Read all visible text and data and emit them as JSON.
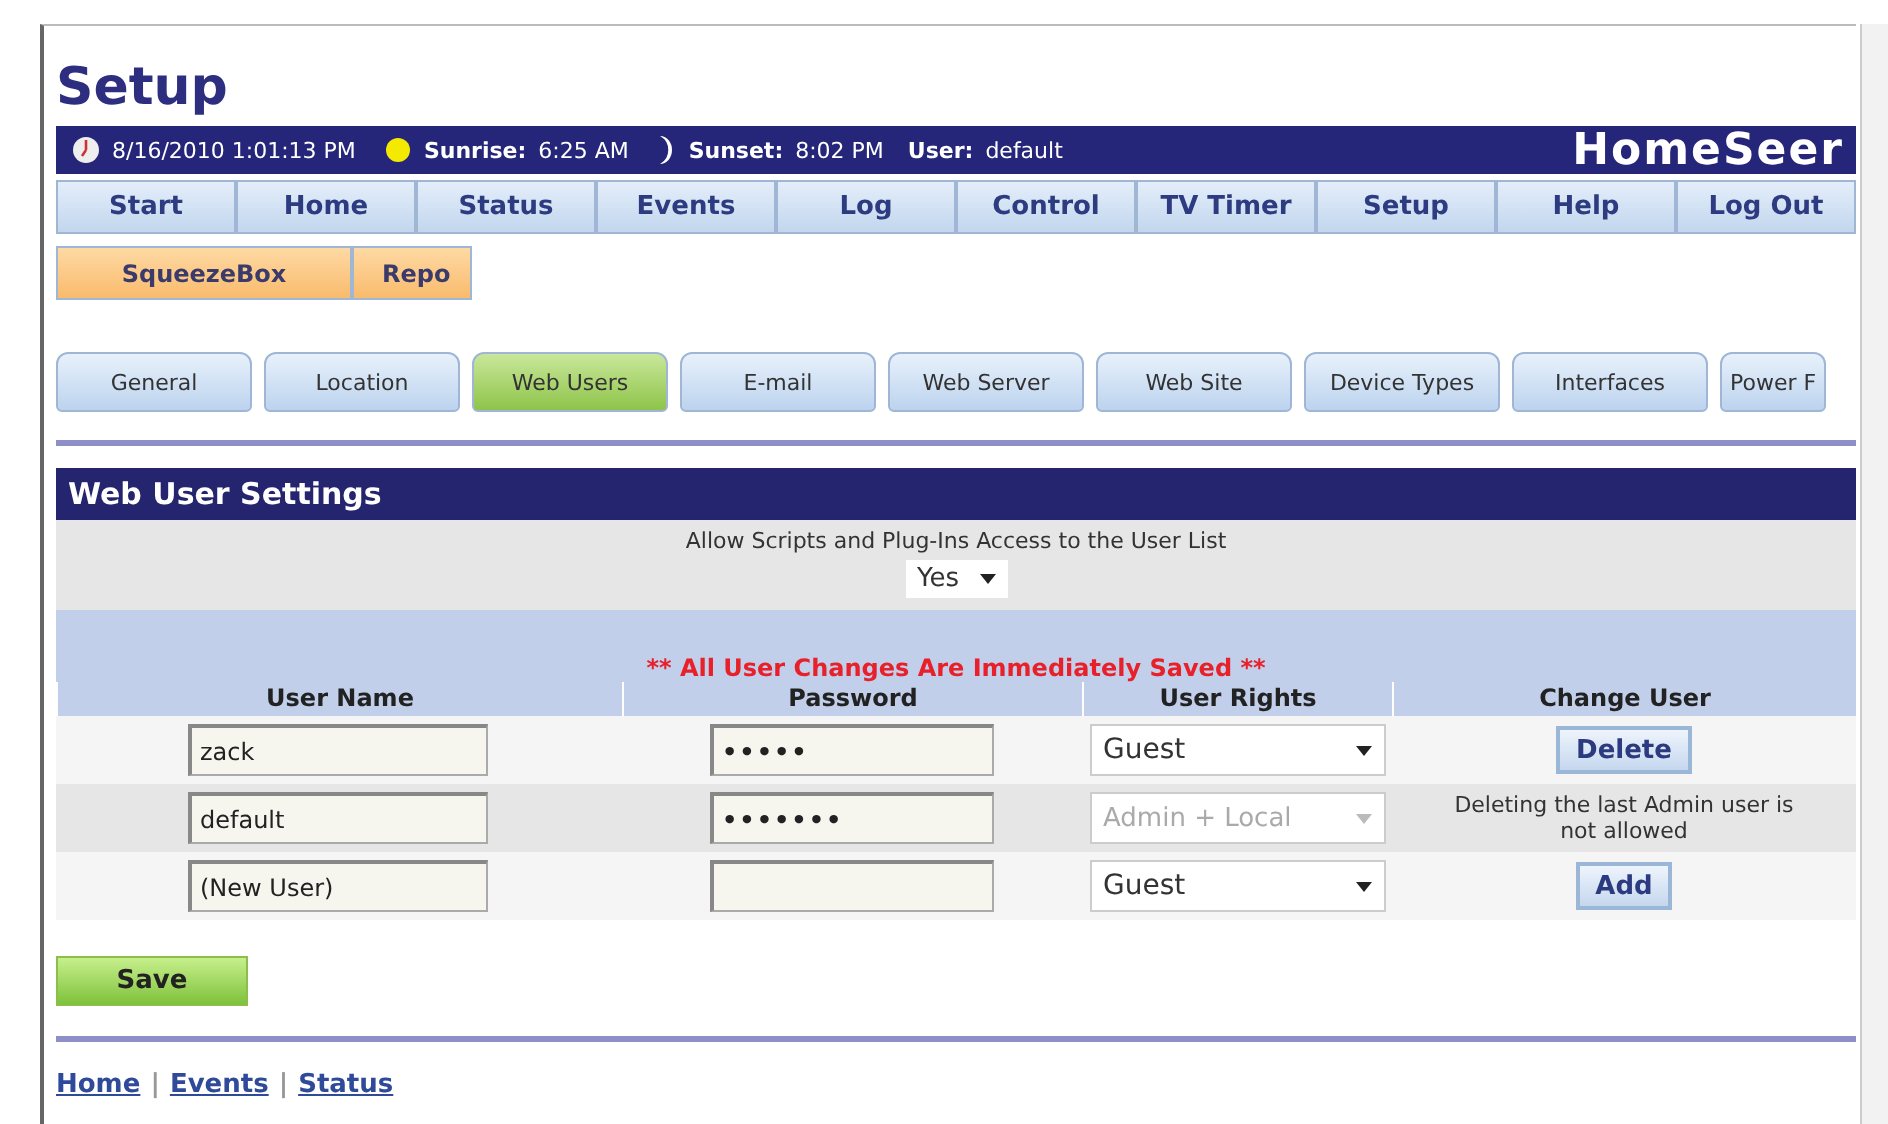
{
  "page_title": "Setup",
  "header": {
    "datetime": "8/16/2010 1:01:13 PM",
    "sunrise_label": "Sunrise:",
    "sunrise": "6:25 AM",
    "sunset_label": "Sunset:",
    "sunset": "8:02 PM",
    "user_label": "User:",
    "user": "default",
    "logo": "HomeSeer"
  },
  "nav": [
    "Start",
    "Home",
    "Status",
    "Events",
    "Log",
    "Control",
    "TV Timer",
    "Setup",
    "Help",
    "Log Out"
  ],
  "subnav": [
    "SqueezeBox",
    "Repo"
  ],
  "tabs": [
    {
      "label": "General",
      "selected": false
    },
    {
      "label": "Location",
      "selected": false
    },
    {
      "label": "Web Users",
      "selected": true
    },
    {
      "label": "E-mail",
      "selected": false
    },
    {
      "label": "Web Server",
      "selected": false
    },
    {
      "label": "Web Site",
      "selected": false
    },
    {
      "label": "Device Types",
      "selected": false
    },
    {
      "label": "Interfaces",
      "selected": false
    },
    {
      "label": "Power F",
      "selected": false
    }
  ],
  "section": {
    "title": "Web User Settings",
    "allow_label": "Allow Scripts and Plug-Ins Access to the User List",
    "allow_value": "Yes",
    "notice": "** All User Changes Are Immediately Saved **",
    "columns": [
      "User Name",
      "Password",
      "User Rights",
      "Change User"
    ],
    "users": [
      {
        "name": "zack",
        "password": "•••••",
        "rights": "Guest",
        "disabled": false,
        "action": {
          "kind": "button",
          "text": "Delete"
        }
      },
      {
        "name": "default",
        "password": "•••••••",
        "rights": "Admin + Local",
        "disabled": true,
        "action": {
          "kind": "note",
          "text": "Deleting the last Admin user is not allowed"
        }
      },
      {
        "name": "(New User)",
        "rights": "Guest",
        "disabled": false,
        "action": {
          "kind": "button",
          "text": "Add"
        }
      }
    ]
  },
  "save": "Save",
  "footer": {
    "links": [
      "Home",
      "Events",
      "Status"
    ],
    "separator": "|"
  }
}
